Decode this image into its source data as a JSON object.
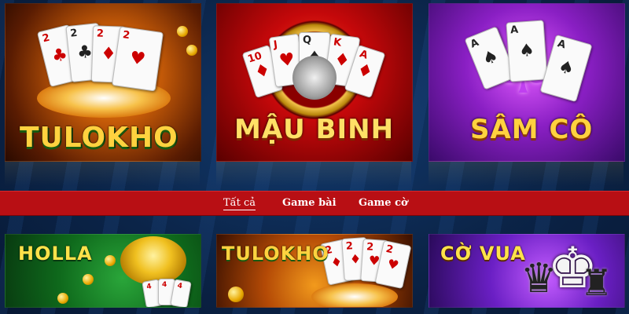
{
  "tiles_top": [
    {
      "label": "TULOKHO"
    },
    {
      "label": "MẬU BINH"
    },
    {
      "label": "SÂM CÔ"
    }
  ],
  "nav": {
    "items": [
      {
        "label": "Tất cả",
        "active": true
      },
      {
        "label": "Game bài",
        "active": false
      },
      {
        "label": "Game cờ",
        "active": false
      }
    ],
    "bar_color": "#b80f14"
  },
  "tiles_bottom": [
    {
      "label": "HOLLA"
    },
    {
      "label": "TULOKHO"
    },
    {
      "label": "CỜ VUA"
    }
  ],
  "card_ranks": {
    "t1": [
      "2",
      "2",
      "2",
      "2"
    ],
    "t2": [
      "10",
      "J",
      "Q",
      "K",
      "A"
    ],
    "t3": [
      "A",
      "A",
      "A"
    ],
    "b2": [
      "2",
      "2",
      "2",
      "2"
    ],
    "b1": [
      "4",
      "4",
      "4"
    ]
  },
  "colors": {
    "background": "#0b2448",
    "title_gold": "#ffd23f"
  }
}
